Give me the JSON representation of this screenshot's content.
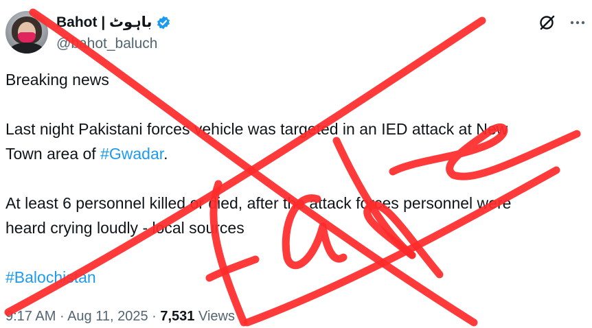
{
  "author": {
    "display_name": "Bahot | باہوٹ",
    "handle": "@bahot_baluch",
    "verified": true,
    "verified_color": "#1d9bf0"
  },
  "actions": {
    "grok_icon": "grok-icon",
    "more_icon": "more-horizontal-icon"
  },
  "tweet": {
    "line1": "Breaking news",
    "line2_text": "Last night Pakistani forces vehicle was targeted in an IED attack at New",
    "line3_prefix": "Town area of ",
    "line3_hashtag": "#Gwadar",
    "line3_suffix": ".",
    "line4": "At least 6 personnel killed or died, after the attack forces personnel were",
    "line5": "heard crying loudly - local sources",
    "hashtag2": "#Balochistan"
  },
  "meta": {
    "time": "9:17 AM",
    "sep1": " · ",
    "date": "Aug 11, 2025",
    "sep2": " · ",
    "views_count": "7,531",
    "views_label": " Views"
  },
  "overlay": {
    "annotation": "FaKe",
    "color": "#ff2b2b"
  },
  "colors": {
    "text": "#0f1419",
    "secondary": "#536471",
    "link": "#1d9bf0"
  }
}
